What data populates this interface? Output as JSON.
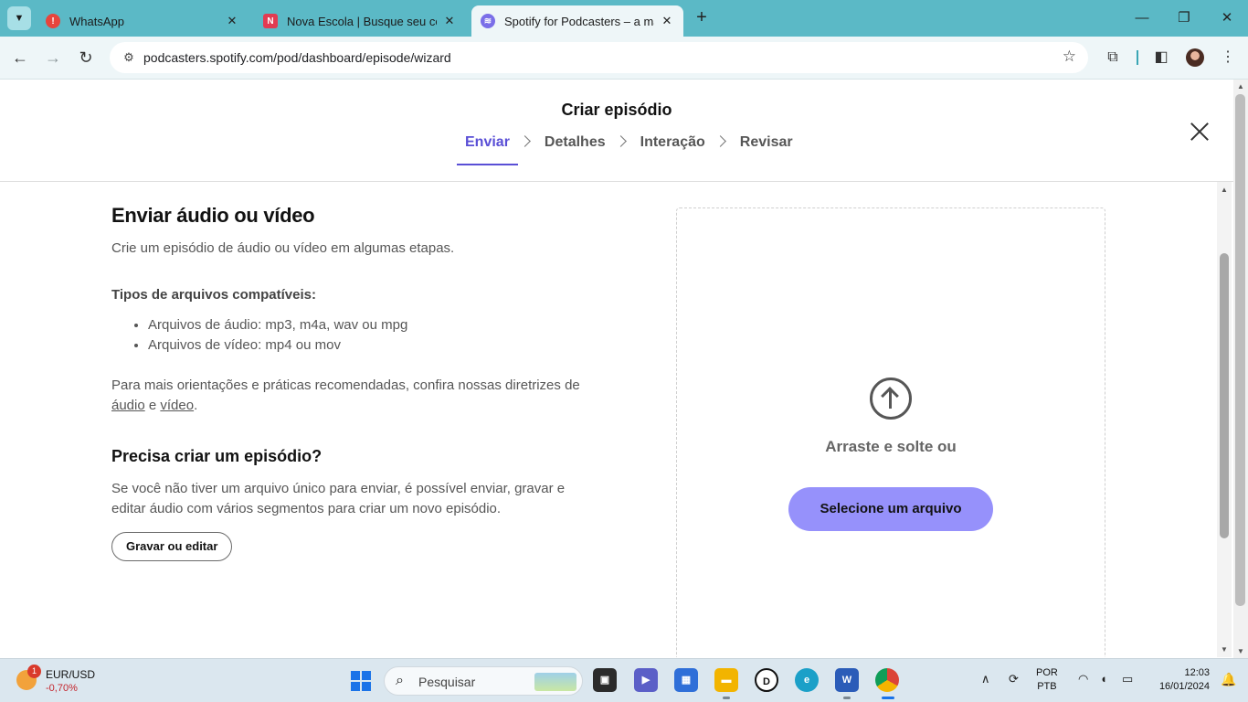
{
  "browser": {
    "tabs": [
      {
        "title": "WhatsApp",
        "icon": "whatsapp-alert-icon",
        "active": false
      },
      {
        "title": "Nova Escola | Busque seu conte",
        "icon": "nova-escola-icon",
        "active": false
      },
      {
        "title": "Spotify for Podcasters – a mane",
        "icon": "spotify-icon",
        "active": true
      }
    ],
    "url": "podcasters.spotify.com/pod/dashboard/episode/wizard"
  },
  "header": {
    "title": "Criar episódio",
    "steps": [
      "Enviar",
      "Detalhes",
      "Interação",
      "Revisar"
    ],
    "active_step": "Enviar"
  },
  "upload": {
    "heading": "Enviar áudio ou vídeo",
    "description": "Crie um episódio de áudio ou vídeo em algumas etapas.",
    "types_heading": "Tipos de arquivos compatíveis:",
    "types": [
      "Arquivos de áudio: mp3, m4a, wav ou mpg",
      "Arquivos de vídeo: mp4 ou mov"
    ],
    "guidance_prefix": "Para mais orientações e práticas recomendadas, confira nossas diretrizes de ",
    "guidance_link_audio": "áudio",
    "guidance_and": " e ",
    "guidance_link_video": "vídeo",
    "guidance_suffix": ".",
    "create_heading": "Precisa criar um episódio?",
    "create_description": "Se você não tiver um arquivo único para enviar, é possível enviar, gravar e editar áudio com vários segmentos para criar um novo episódio.",
    "record_button": "Gravar ou editar",
    "drop_text": "Arraste e solte ou",
    "select_button": "Selecione um arquivo"
  },
  "taskbar": {
    "widget_badge": "1",
    "widget_name": "EUR/USD",
    "widget_value": "-0,70%",
    "search_placeholder": "Pesquisar",
    "lang_line1": "POR",
    "lang_line2": "PTB",
    "time": "12:03",
    "date": "16/01/2024"
  },
  "colors": {
    "accent": "#5a4fd6",
    "select_button": "#9691fb",
    "tab_strip": "#5bb9c6"
  }
}
